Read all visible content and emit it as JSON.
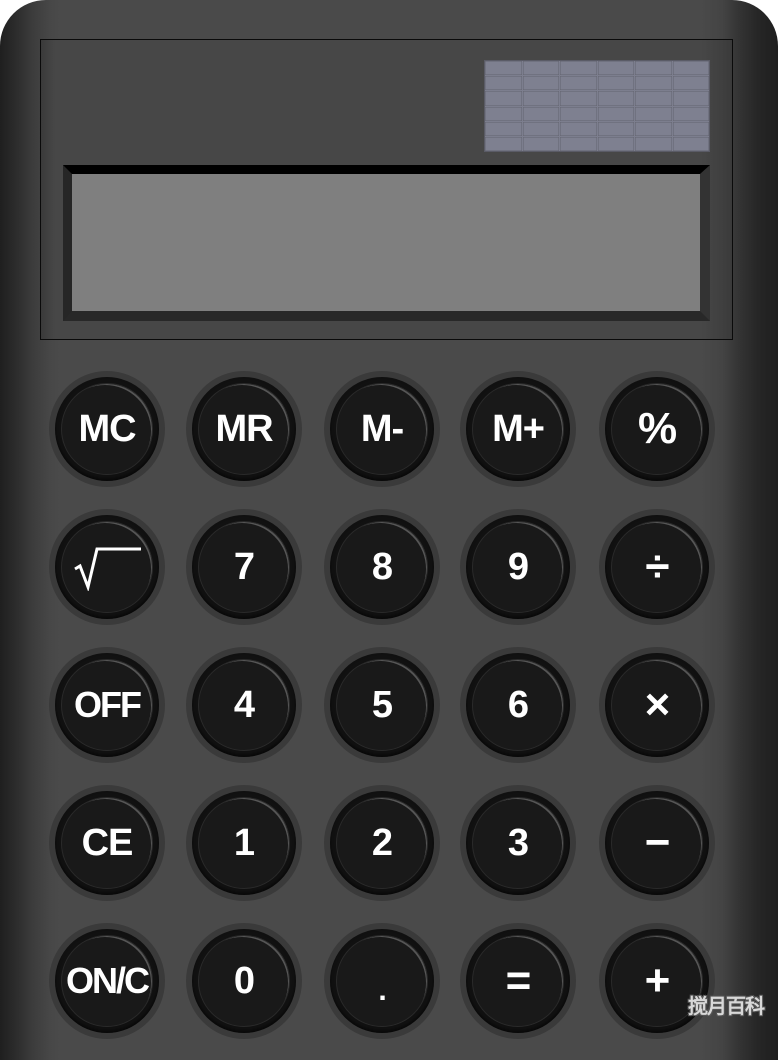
{
  "display": {
    "value": "",
    "solar_panel": {
      "rows": 6,
      "cols": 6,
      "color": "#7e8090"
    },
    "screen_color": "#7f7f7f"
  },
  "keypad": {
    "rows": [
      [
        {
          "id": "mc",
          "label": "MC"
        },
        {
          "id": "mr",
          "label": "MR"
        },
        {
          "id": "m-minus",
          "label": "M-"
        },
        {
          "id": "m-plus",
          "label": "M+"
        },
        {
          "id": "percent",
          "label": "%"
        }
      ],
      [
        {
          "id": "sqrt",
          "label": "√",
          "icon": "square-root-icon"
        },
        {
          "id": "7",
          "label": "7"
        },
        {
          "id": "8",
          "label": "8"
        },
        {
          "id": "9",
          "label": "9"
        },
        {
          "id": "divide",
          "label": "÷"
        }
      ],
      [
        {
          "id": "off",
          "label": "OFF"
        },
        {
          "id": "4",
          "label": "4"
        },
        {
          "id": "5",
          "label": "5"
        },
        {
          "id": "6",
          "label": "6"
        },
        {
          "id": "multiply",
          "label": "×"
        }
      ],
      [
        {
          "id": "ce",
          "label": "CE"
        },
        {
          "id": "1",
          "label": "1"
        },
        {
          "id": "2",
          "label": "2"
        },
        {
          "id": "3",
          "label": "3"
        },
        {
          "id": "minus",
          "label": "−"
        }
      ],
      [
        {
          "id": "on-c",
          "label": "ON/C"
        },
        {
          "id": "0",
          "label": "0"
        },
        {
          "id": "decimal",
          "label": "."
        },
        {
          "id": "equals",
          "label": "="
        },
        {
          "id": "plus",
          "label": "+"
        }
      ]
    ]
  },
  "colors": {
    "body": "#4a4a4a",
    "key": "#191919",
    "key_text": "#ffffff"
  },
  "watermark": "搅月百科"
}
